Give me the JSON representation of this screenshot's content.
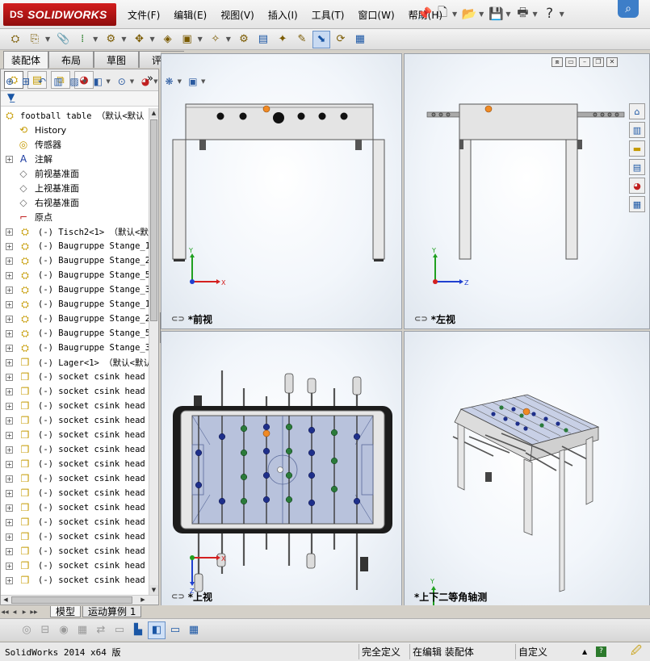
{
  "app": {
    "logo_prefix": "DS",
    "logo_text": "SOLIDWORKS"
  },
  "menu": [
    "文件(F)",
    "编辑(E)",
    "视图(V)",
    "插入(I)",
    "工具(T)",
    "窗口(W)",
    "帮助(H)"
  ],
  "tabs": [
    "装配体",
    "布局",
    "草图",
    "评估"
  ],
  "active_tab": "装配体",
  "tree": {
    "root_label": "football table （默认<默认",
    "items": [
      {
        "label": "History",
        "icon": "history-icon",
        "expand": false,
        "mono": false
      },
      {
        "label": "传感器",
        "icon": "sensor-icon",
        "expand": false,
        "mono": false
      },
      {
        "label": "注解",
        "icon": "annotation-icon",
        "expand": true,
        "mono": false
      },
      {
        "label": "前视基准面",
        "icon": "plane-icon",
        "expand": false,
        "mono": false
      },
      {
        "label": "上视基准面",
        "icon": "plane-icon",
        "expand": false,
        "mono": false
      },
      {
        "label": "右视基准面",
        "icon": "plane-icon",
        "expand": false,
        "mono": false
      },
      {
        "label": "原点",
        "icon": "origin-icon",
        "expand": false,
        "mono": false
      },
      {
        "label": "(-) Tisch2<1> （默认<默认",
        "icon": "assembly-icon",
        "expand": true,
        "mono": true
      },
      {
        "label": "(-) Baugruppe Stange_1e",
        "icon": "assembly-icon",
        "expand": true,
        "mono": true
      },
      {
        "label": "(-) Baugruppe Stange_2e",
        "icon": "assembly-icon",
        "expand": true,
        "mono": true
      },
      {
        "label": "(-) Baugruppe Stange_5e",
        "icon": "assembly-icon",
        "expand": true,
        "mono": true
      },
      {
        "label": "(-) Baugruppe Stange_3e",
        "icon": "assembly-icon",
        "expand": true,
        "mono": true
      },
      {
        "label": "(-) Baugruppe Stange_1e",
        "icon": "assembly-icon",
        "expand": true,
        "mono": true
      },
      {
        "label": "(-) Baugruppe Stange_2e",
        "icon": "assembly-icon",
        "expand": true,
        "mono": true
      },
      {
        "label": "(-) Baugruppe Stange_5e",
        "icon": "assembly-icon",
        "expand": true,
        "mono": true
      },
      {
        "label": "(-) Baugruppe Stange_3e",
        "icon": "assembly-icon",
        "expand": true,
        "mono": true
      },
      {
        "label": "(-) Lager<1> （默认<默认",
        "icon": "part-icon",
        "expand": true,
        "mono": true
      },
      {
        "label": "(-) socket csink head c",
        "icon": "part-icon",
        "expand": true,
        "mono": true
      },
      {
        "label": "(-) socket csink head c",
        "icon": "part-icon",
        "expand": true,
        "mono": true
      },
      {
        "label": "(-) socket csink head c",
        "icon": "part-icon",
        "expand": true,
        "mono": true
      },
      {
        "label": "(-) socket csink head c",
        "icon": "part-icon",
        "expand": true,
        "mono": true
      },
      {
        "label": "(-) socket csink head c",
        "icon": "part-icon",
        "expand": true,
        "mono": true
      },
      {
        "label": "(-) socket csink head c",
        "icon": "part-icon",
        "expand": true,
        "mono": true
      },
      {
        "label": "(-) socket csink head c",
        "icon": "part-icon",
        "expand": true,
        "mono": true
      },
      {
        "label": "(-) socket csink head c",
        "icon": "part-icon",
        "expand": true,
        "mono": true
      },
      {
        "label": "(-) socket csink head c",
        "icon": "part-icon",
        "expand": true,
        "mono": true
      },
      {
        "label": "(-) socket csink head c",
        "icon": "part-icon",
        "expand": true,
        "mono": true
      },
      {
        "label": "(-) socket csink head c",
        "icon": "part-icon",
        "expand": true,
        "mono": true
      },
      {
        "label": "(-) socket csink head c",
        "icon": "part-icon",
        "expand": true,
        "mono": true
      },
      {
        "label": "(-) socket csink head c",
        "icon": "part-icon",
        "expand": true,
        "mono": true
      },
      {
        "label": "(-) socket csink head c",
        "icon": "part-icon",
        "expand": true,
        "mono": true
      },
      {
        "label": "(-) socket csink head c",
        "icon": "part-icon",
        "expand": true,
        "mono": true
      }
    ]
  },
  "viewports": {
    "front": "*前视",
    "left": "*左视",
    "top": "*上视",
    "iso": "*上下二等角轴测"
  },
  "axes": {
    "x": "X",
    "y": "Y",
    "z": "Z"
  },
  "model_tabs": [
    "模型",
    "运动算例 1"
  ],
  "active_model_tab": "模型",
  "status": {
    "app": "SolidWorks 2014 x64 版",
    "constraint": "完全定义",
    "editing": "在编辑 装配体",
    "units": "自定义"
  },
  "colors": {
    "logo_red": "#c41a1a",
    "selection_orange": "#f08a24",
    "axis_x": "#d42020",
    "axis_y": "#20a020",
    "axis_z": "#2040d0",
    "player_blue": "#1e2f8a",
    "table_frame": "#dcdcdc"
  }
}
